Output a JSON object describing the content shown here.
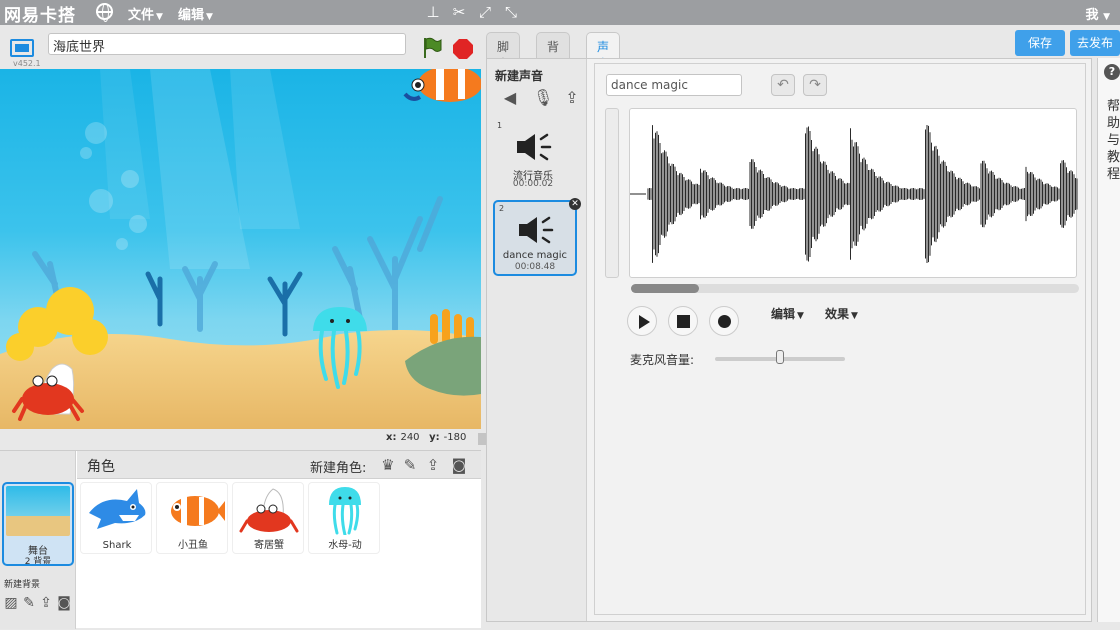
{
  "topbar": {
    "logo": "网易卡搭",
    "menu_file": "文件",
    "menu_edit": "编辑",
    "user": "我"
  },
  "stage": {
    "version": "v452.1",
    "project_title": "海底世界",
    "coord_x_label": "x:",
    "coord_x": "240",
    "coord_y_label": "y:",
    "coord_y": "-180"
  },
  "sprites": {
    "label": "角色",
    "new_label": "新建角色:",
    "stage_name": "舞台",
    "stage_bg_count": "2 背景",
    "new_bg_label": "新建背景",
    "items": [
      {
        "name": "Shark",
        "color": "#2e8be6"
      },
      {
        "name": "小丑鱼",
        "color": "#f57a1e"
      },
      {
        "name": "寄居蟹",
        "color": "#e2371f"
      },
      {
        "name": "水母-动",
        "color": "#3fdcea"
      }
    ]
  },
  "tabs": [
    "脚本",
    "背景",
    "声音"
  ],
  "active_tab": "声音",
  "actions": {
    "save": "保存",
    "publish": "去发布"
  },
  "sounds": {
    "new_label": "新建声音",
    "items": [
      {
        "num": "1",
        "name": "流行音乐",
        "duration": "00:00.02"
      },
      {
        "num": "2",
        "name": "dance magic",
        "duration": "00:08.48"
      }
    ],
    "selected_index": 2
  },
  "editor": {
    "sound_name": "dance magic",
    "edit_menu": "编辑",
    "effect_menu": "效果",
    "mic_label": "麦克风音量:",
    "mic_volume": 0.5,
    "scroll_position": 0.0
  },
  "help": {
    "text": "帮助与教程"
  },
  "colors": {
    "accent": "#1c8be0",
    "topbar": "#9c9ea1",
    "button": "#3fa0ea",
    "stop": "#e02424"
  }
}
